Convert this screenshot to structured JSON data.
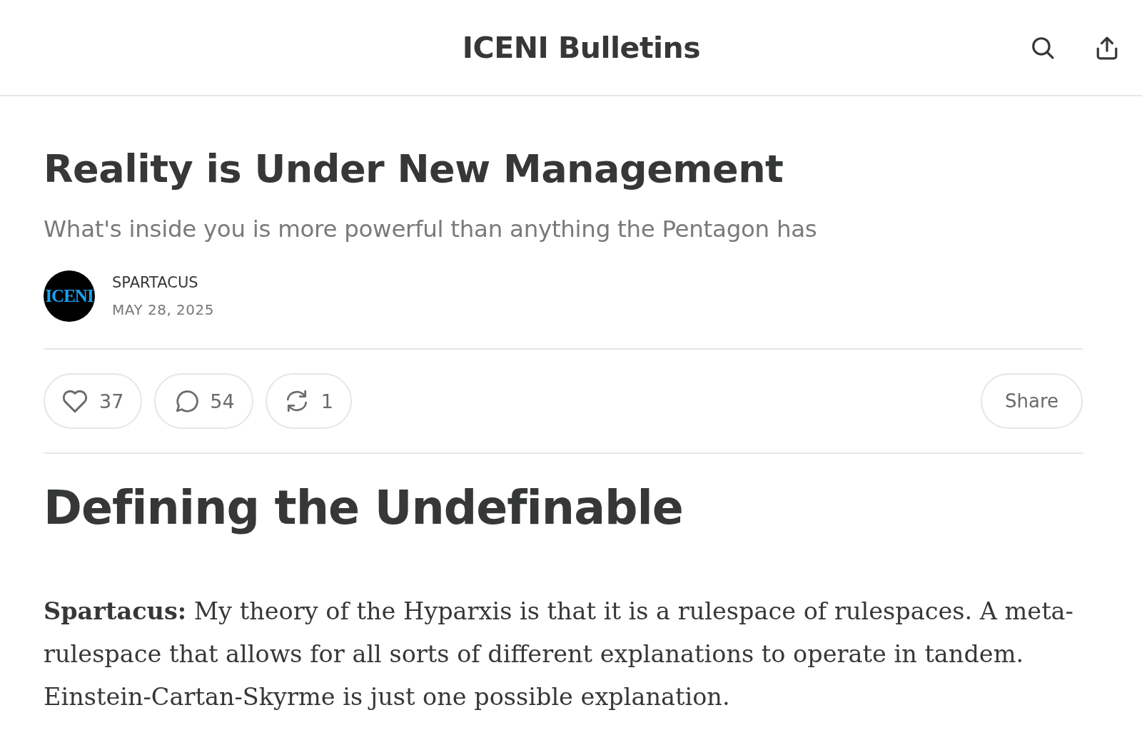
{
  "header": {
    "title": "ICENI Bulletins"
  },
  "post": {
    "title": "Reality is Under New Management",
    "subtitle": "What's inside you is more powerful than anything the Pentagon has",
    "author": {
      "logo_text": "ICENI",
      "name": "SPARTACUS",
      "date": "MAY 28, 2025"
    },
    "actions": [
      {
        "kind": "like",
        "count": "37"
      },
      {
        "kind": "comment",
        "count": "54"
      },
      {
        "kind": "restack",
        "count": "1"
      }
    ],
    "share": {
      "label": "Share"
    }
  },
  "body": {
    "heading": "Defining the Undefinable",
    "paragraphs": [
      "**Spartacus:** My theory of the Hyparxis is that it is a rulespace of rulespaces. A meta-rulespace that allows for all sorts of different explanations to operate in tandem. Einstein-Cartan-Skyrme is just one possible explanation."
    ]
  }
}
